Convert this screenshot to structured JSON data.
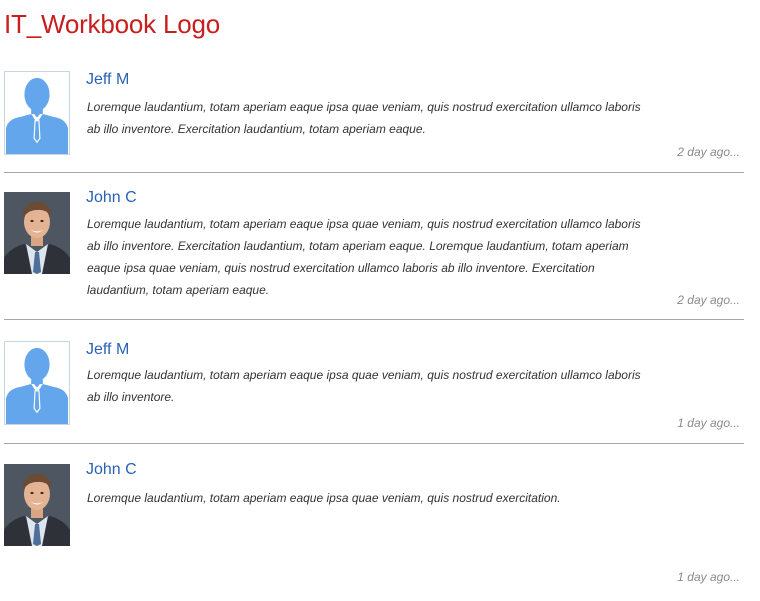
{
  "header": {
    "logo_text": "IT_Workbook Logo",
    "logo_color": "#c81e1e"
  },
  "comments": [
    {
      "author": "Jeff M",
      "avatar": "silhouette-avatar-icon",
      "text": "Loremque laudantium, totam aperiam eaque ipsa quae veniam, quis nostrud exercitation ullamco laboris ab illo inventore. Exercitation laudantium, totam aperiam eaque.",
      "time": "2 day ago..."
    },
    {
      "author": "John C",
      "avatar": "profile-photo",
      "text": "Loremque laudantium, totam aperiam eaque ipsa quae veniam, quis nostrud exercitation ullamco laboris ab illo inventore. Exercitation laudantium, totam aperiam eaque. Loremque laudantium, totam aperiam eaque ipsa quae veniam, quis nostrud exercitation ullamco laboris ab illo inventore. Exercitation laudantium, totam aperiam eaque.",
      "time": "2 day ago..."
    },
    {
      "author": "Jeff M",
      "avatar": "silhouette-avatar-icon",
      "text": "Loremque laudantium, totam aperiam eaque ipsa quae veniam, quis nostrud exercitation ullamco laboris ab illo inventore.",
      "time": "1 day ago..."
    },
    {
      "author": "John C",
      "avatar": "profile-photo",
      "text": "Loremque laudantium, totam aperiam eaque ipsa quae veniam, quis nostrud exercitation.",
      "time": "1 day ago..."
    }
  ],
  "colors": {
    "author_link": "#2a63b4",
    "timestamp": "#8a8a8a",
    "divider": "#a8a8a8",
    "silhouette": "#63a6ec"
  }
}
